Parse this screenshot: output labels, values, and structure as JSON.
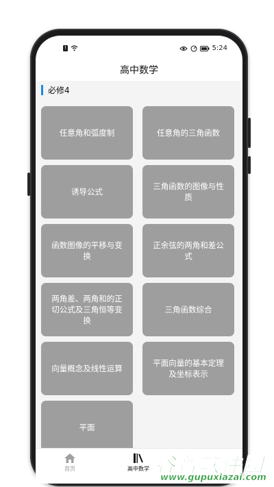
{
  "status_bar": {
    "time": "5:24",
    "left_icons": [
      "sim-alert-icon",
      "wifi-icon"
    ],
    "right_icons": [
      "eye-icon",
      "gauge-icon",
      "battery-icon"
    ]
  },
  "header": {
    "title": "高中数学"
  },
  "section": {
    "title": "必修4",
    "accent_color": "#1e88e5"
  },
  "cards": [
    {
      "label": "任意角和弧度制"
    },
    {
      "label": "任意角的三角函数"
    },
    {
      "label": "诱导公式"
    },
    {
      "label": "三角函数的图像与性质"
    },
    {
      "label": "函数图像的平移与变换"
    },
    {
      "label": "正余弦的两角和差公式"
    },
    {
      "label": "两角差、两角和的正切公式及三角恒等变换"
    },
    {
      "label": "三角函数综合"
    },
    {
      "label": "向量概念及线性运算"
    },
    {
      "label": "平面向量的基本定理及坐标表示"
    },
    {
      "label": "平面"
    }
  ],
  "tabbar": {
    "items": [
      {
        "label": "首页",
        "icon": "home-icon",
        "active": false
      },
      {
        "label": "高中数学",
        "icon": "book-icon",
        "active": true
      }
    ]
  },
  "watermark": {
    "logo": "谷普软件园",
    "url": "www.gupuxiazai.com",
    "color": "#2e9b3e"
  }
}
